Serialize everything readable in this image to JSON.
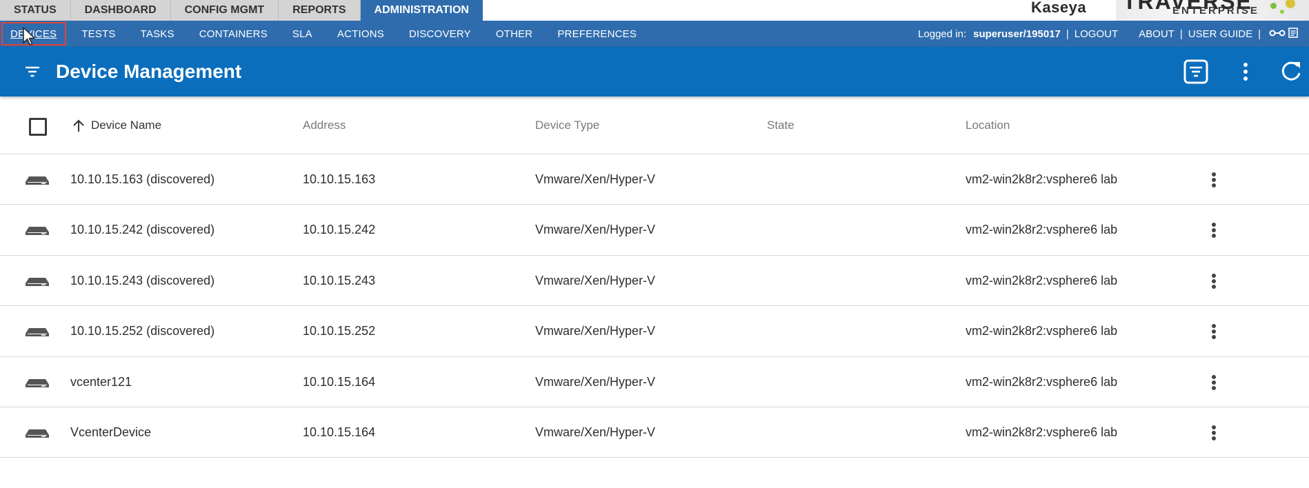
{
  "top_tabs": [
    {
      "label": "STATUS",
      "active": false
    },
    {
      "label": "DASHBOARD",
      "active": false
    },
    {
      "label": "CONFIG MGMT",
      "active": false
    },
    {
      "label": "REPORTS",
      "active": false
    },
    {
      "label": "ADMINISTRATION",
      "active": true
    }
  ],
  "brand": {
    "vendor": "Kaseya",
    "product": "TRAVERSE",
    "edition": "ENTERPRISE"
  },
  "sub_nav": {
    "items": [
      "DEVICES",
      "TESTS",
      "TASKS",
      "CONTAINERS",
      "SLA",
      "ACTIONS",
      "DISCOVERY",
      "OTHER",
      "PREFERENCES"
    ],
    "selected": "DEVICES"
  },
  "user_bar": {
    "logged_in_label": "Logged in:",
    "username": "superuser/195017",
    "separator": "|",
    "logout": "LOGOUT",
    "about": "ABOUT",
    "user_guide": "USER GUIDE"
  },
  "header": {
    "title": "Device Management"
  },
  "table": {
    "columns": [
      "Device Name",
      "Address",
      "Device Type",
      "State",
      "Location"
    ],
    "sort": {
      "column": "Device Name",
      "direction": "ascending"
    },
    "rows": [
      {
        "name": "10.10.15.163 (discovered)",
        "address": "10.10.15.163",
        "type": "Vmware/Xen/Hyper-V",
        "state": "",
        "location": "vm2-win2k8r2:vsphere6 lab"
      },
      {
        "name": "10.10.15.242 (discovered)",
        "address": "10.10.15.242",
        "type": "Vmware/Xen/Hyper-V",
        "state": "",
        "location": "vm2-win2k8r2:vsphere6 lab"
      },
      {
        "name": "10.10.15.243 (discovered)",
        "address": "10.10.15.243",
        "type": "Vmware/Xen/Hyper-V",
        "state": "",
        "location": "vm2-win2k8r2:vsphere6 lab"
      },
      {
        "name": "10.10.15.252 (discovered)",
        "address": "10.10.15.252",
        "type": "Vmware/Xen/Hyper-V",
        "state": "",
        "location": "vm2-win2k8r2:vsphere6 lab"
      },
      {
        "name": "vcenter121",
        "address": "10.10.15.164",
        "type": "Vmware/Xen/Hyper-V",
        "state": "",
        "location": "vm2-win2k8r2:vsphere6 lab"
      },
      {
        "name": "VcenterDevice",
        "address": "10.10.15.164",
        "type": "Vmware/Xen/Hyper-V",
        "state": "",
        "location": "vm2-win2k8r2:vsphere6 lab"
      }
    ]
  },
  "icons": {
    "filter": "filter-list-icon",
    "column_picker": "column-filter-icon",
    "more": "more-vert-icon",
    "refresh": "refresh-icon",
    "device": "server-device-icon",
    "sort": "arrow-up-icon"
  },
  "colors": {
    "nav_blue": "#2f6cad",
    "header_blue": "#0a6ebd",
    "tab_gray": "#d4d4d4",
    "highlight_red": "#e0433a"
  }
}
